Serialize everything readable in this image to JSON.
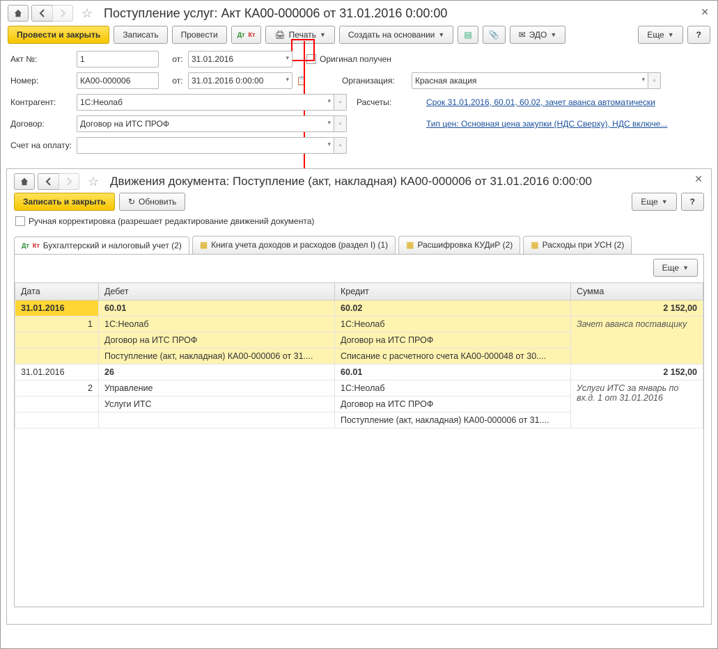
{
  "win1": {
    "title": "Поступление услуг: Акт КА00-000006 от 31.01.2016 0:00:00",
    "toolbar": {
      "post_close": "Провести и закрыть",
      "save": "Записать",
      "post": "Провести",
      "print": "Печать",
      "create_based": "Создать на основании",
      "edo": "ЭДО",
      "more": "Еще",
      "help": "?"
    },
    "fields": {
      "act_no_lbl": "Акт №:",
      "act_no": "1",
      "from_lbl": "от:",
      "act_date": "31.01.2016",
      "original_lbl": "Оригинал получен",
      "number_lbl": "Номер:",
      "number": "КА00-000006",
      "number_date": "31.01.2016  0:00:00",
      "org_lbl": "Организация:",
      "org": "Красная акация",
      "contr_lbl": "Контрагент:",
      "contr": "1С:Неолаб",
      "calc_lbl": "Расчеты:",
      "calc_link": "Срок 31.01.2016, 60.01, 60.02, зачет аванса автоматически",
      "dogovor_lbl": "Договор:",
      "dogovor": "Договор на ИТС ПРОФ",
      "price_type_link": "Тип цен: Основная цена закупки (НДС Сверху), НДС включе...",
      "invoice_lbl": "Счет на оплату:"
    }
  },
  "win2": {
    "title": "Движения документа: Поступление (акт, накладная) КА00-000006 от 31.01.2016 0:00:00",
    "toolbar": {
      "save_close": "Записать и закрыть",
      "refresh": "Обновить",
      "more": "Еще",
      "help": "?"
    },
    "manual_lbl": "Ручная корректировка (разрешает редактирование движений документа)",
    "tabs": {
      "t1": "Бухгалтерский и налоговый учет (2)",
      "t2": "Книга учета доходов и расходов (раздел I) (1)",
      "t3": "Расшифровка КУДиР (2)",
      "t4": "Расходы при УСН (2)"
    },
    "more_btn": "Еще",
    "table": {
      "h_date": "Дата",
      "h_debit": "Дебет",
      "h_credit": "Кредит",
      "h_sum": "Сумма",
      "rows": [
        {
          "date": "31.01.2016",
          "n": "1",
          "debit_acc": "60.01",
          "credit_acc": "60.02",
          "sum": "2 152,00",
          "d1": "1С:Неолаб",
          "c1": "1С:Неолаб",
          "note": "Зачет аванса поставщику",
          "d2": "Договор на ИТС ПРОФ",
          "c2": "Договор на ИТС ПРОФ",
          "d3": "Поступление (акт, накладная) КА00-000006 от 31....",
          "c3": "Списание с расчетного счета КА00-000048 от 30...."
        },
        {
          "date": "31.01.2016",
          "n": "2",
          "debit_acc": "26",
          "credit_acc": "60.01",
          "sum": "2 152,00",
          "d1": "Управление",
          "c1": "1С:Неолаб",
          "note": "Услуги ИТС за январь по вх.д. 1 от 31.01.2016",
          "d2": "Услуги ИТС",
          "c2": "Договор на ИТС ПРОФ",
          "d3": "",
          "c3": "Поступление (акт, накладная) КА00-000006 от 31...."
        }
      ]
    }
  }
}
